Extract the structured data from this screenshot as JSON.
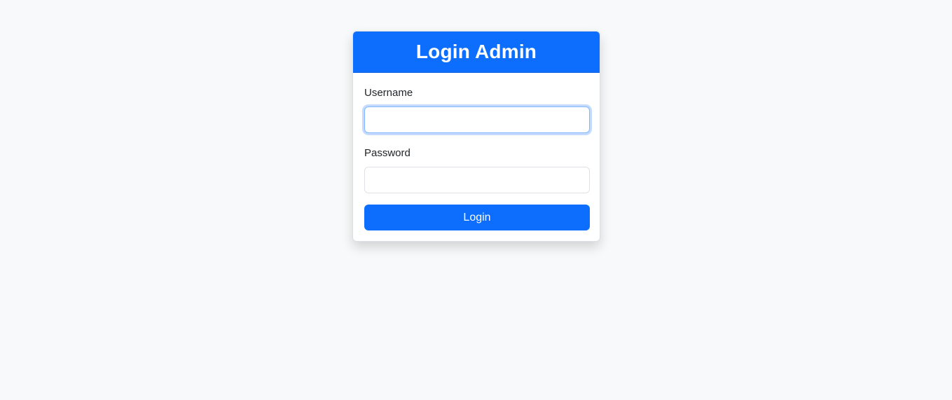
{
  "login_card": {
    "title": "Login Admin",
    "username": {
      "label": "Username",
      "value": "",
      "placeholder": ""
    },
    "password": {
      "label": "Password",
      "value": "",
      "placeholder": ""
    },
    "submit_label": "Login"
  },
  "colors": {
    "primary": "#0d6efd",
    "background": "#f8f9fa",
    "card": "#ffffff"
  }
}
